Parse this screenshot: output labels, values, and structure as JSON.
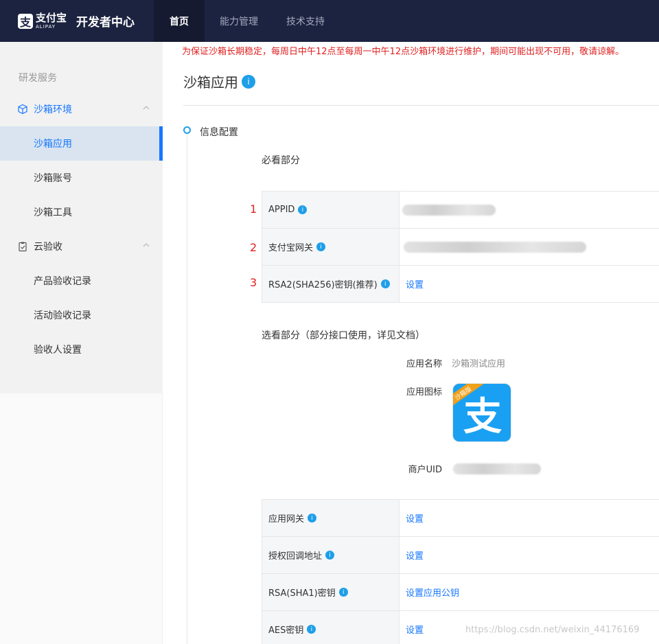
{
  "header": {
    "logo_cn": "支付宝",
    "logo_en": "ALIPAY",
    "logo_glyph": "支",
    "site_title": "开发者中心",
    "nav": [
      {
        "label": "首页",
        "active": true
      },
      {
        "label": "能力管理",
        "active": false
      },
      {
        "label": "技术支持",
        "active": false
      }
    ]
  },
  "sidebar": {
    "section": "研发服务",
    "groups": [
      {
        "label": "沙箱环境",
        "icon": "cube-icon",
        "items": [
          {
            "label": "沙箱应用",
            "active": true
          },
          {
            "label": "沙箱账号",
            "active": false
          },
          {
            "label": "沙箱工具",
            "active": false
          }
        ]
      },
      {
        "label": "云验收",
        "icon": "clipboard-check-icon",
        "items": [
          {
            "label": "产品验收记录",
            "active": false
          },
          {
            "label": "活动验收记录",
            "active": false
          },
          {
            "label": "验收人设置",
            "active": false
          }
        ]
      }
    ]
  },
  "main": {
    "notice": "为保证沙箱长期稳定，每周日中午12点至每周一中午12点沙箱环境进行维护，期间可能出现不可用，敬请谅解。",
    "title": "沙箱应用",
    "title_badge": "i",
    "step_label": "信息配置",
    "required_label": "必看部分",
    "required_rows": [
      {
        "num": "1",
        "key": "APPID",
        "value_type": "blurred"
      },
      {
        "num": "2",
        "key": "支付宝网关",
        "value_type": "blurred"
      },
      {
        "num": "3",
        "key": "RSA2(SHA256)密钥(推荐)",
        "value_type": "link",
        "value": "设置"
      }
    ],
    "optional_label": "选看部分（部分接口使用，详见文档）",
    "app_info": {
      "name_key": "应用名称",
      "name_value": "沙箱测试应用",
      "icon_key": "应用图标",
      "icon_glyph": "支",
      "icon_ribbon": "沙箱版",
      "uid_key": "商户UID"
    },
    "optional_rows": [
      {
        "key": "应用网关",
        "value": "设置"
      },
      {
        "key": "授权回调地址",
        "value": "设置"
      },
      {
        "key": "RSA(SHA1)密钥",
        "value": "设置应用公钥"
      },
      {
        "key": "AES密钥",
        "value": "设置"
      }
    ],
    "row_badge": "i"
  },
  "watermark": "https://blog.csdn.net/weixin_44176169",
  "colors": {
    "header_bg": "#1c2340",
    "accent": "#1677ff",
    "notice": "#e02020",
    "badge": "#1e9fe8"
  }
}
